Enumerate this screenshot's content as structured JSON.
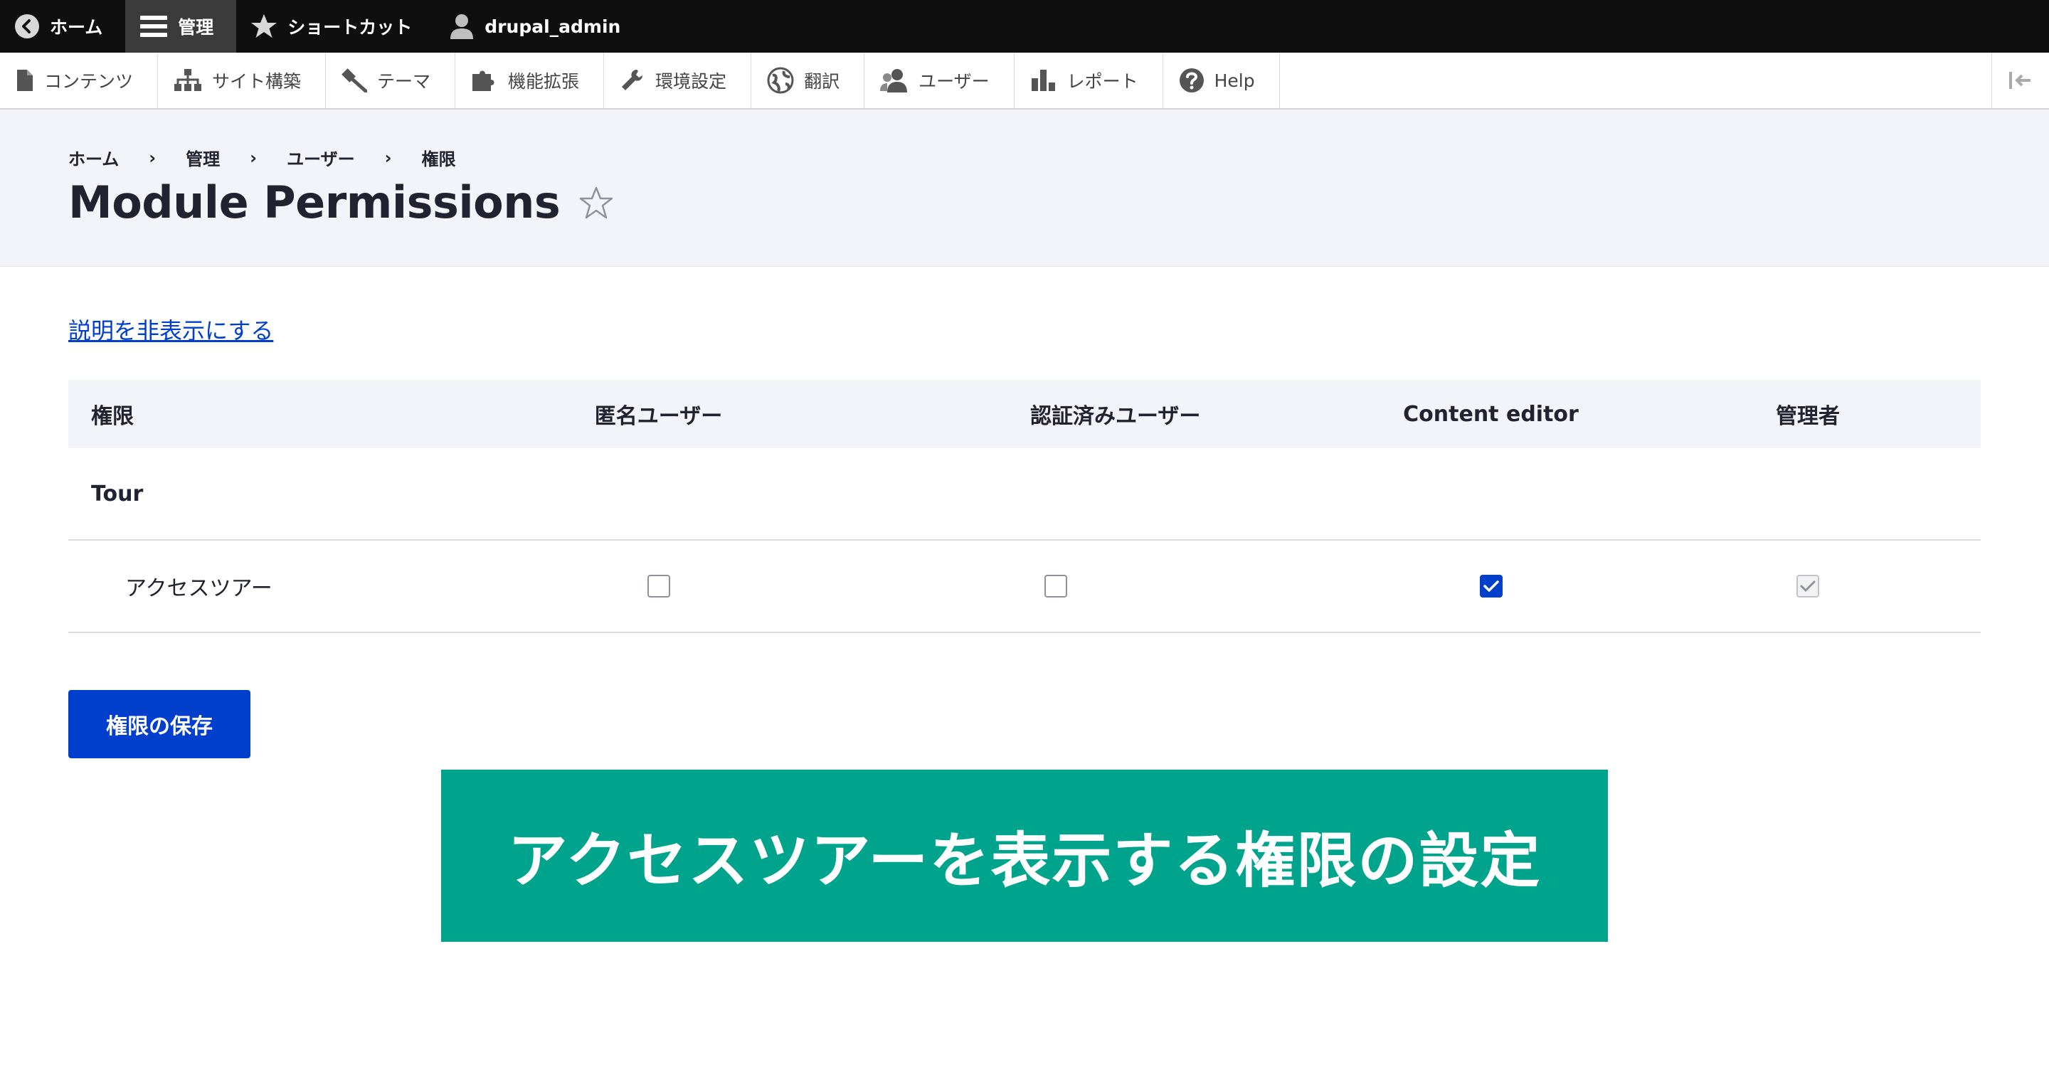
{
  "toolbar": {
    "home": "ホーム",
    "manage": "管理",
    "shortcuts": "ショートカット",
    "user": "drupal_admin"
  },
  "tray": {
    "items": [
      "コンテンツ",
      "サイト構築",
      "テーマ",
      "機能拡張",
      "環境設定",
      "翻訳",
      "ユーザー",
      "レポート",
      "Help"
    ]
  },
  "breadcrumb": [
    "ホーム",
    "管理",
    "ユーザー",
    "権限"
  ],
  "breadcrumb_sep": "›",
  "page": {
    "title": "Module Permissions",
    "star": "☆"
  },
  "content": {
    "hide_description_link": "説明を非表示にする",
    "table": {
      "headers": [
        "権限",
        "匿名ユーザー",
        "認証済みユーザー",
        "Content editor",
        "管理者"
      ],
      "group": "Tour",
      "rows": [
        {
          "label": "アクセスツアー",
          "anonymous": false,
          "authenticated": false,
          "content_editor": true,
          "administrator": true,
          "administrator_disabled": true
        }
      ]
    },
    "save_button": "権限の保存"
  },
  "banner": {
    "text": "アクセスツアーを表示する権限の設定"
  },
  "colors": {
    "accent": "#003ecc",
    "banner": "#00a48c",
    "toolbar": "#0f0f0f"
  }
}
